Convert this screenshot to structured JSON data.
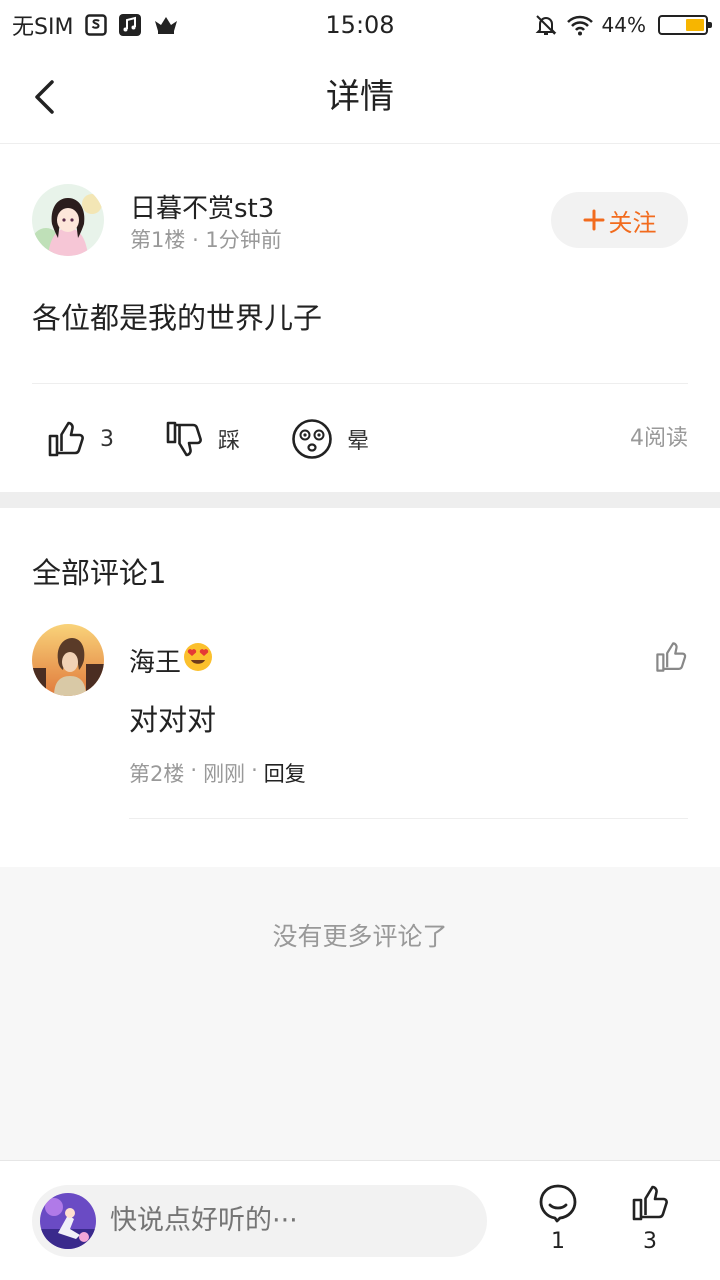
{
  "status_bar": {
    "carrier": "无SIM",
    "time": "15:08",
    "battery": "44%",
    "battery_level": 0.44,
    "battery_color": "#f7b500"
  },
  "nav": {
    "back_icon": "chevron-left-icon",
    "title": "详情"
  },
  "post": {
    "author": "日暮不赏st3",
    "floor": "第1楼",
    "time": "1分钟前",
    "follow": "关注",
    "content": "各位都是我的世界儿子",
    "like_count": "3",
    "dislike_label": "踩",
    "dizzy_label": "晕",
    "reads": "4阅读"
  },
  "comments": {
    "title": "全部评论1",
    "items": [
      {
        "user": "海王",
        "emoji": "😍",
        "text": "对对对",
        "floor": "第2楼",
        "time": "刚刚",
        "reply": "回复"
      }
    ],
    "no_more": "没有更多评论了"
  },
  "bottom": {
    "placeholder": "快说点好听的···",
    "comment_count": "1",
    "like_count": "3"
  },
  "colors": {
    "accent": "#f26b1d",
    "muted": "#999999",
    "divider": "#eeeeee"
  }
}
